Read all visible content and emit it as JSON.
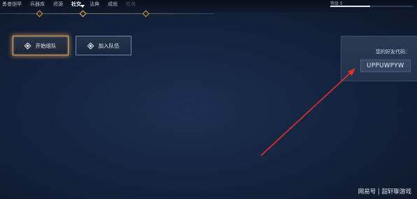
{
  "nav": {
    "tabs": [
      {
        "label": "勇者铠甲",
        "state": "normal"
      },
      {
        "label": "兵器库",
        "state": "normal"
      },
      {
        "label": "资源",
        "state": "normal"
      },
      {
        "label": "社交",
        "state": "active"
      },
      {
        "label": "法典",
        "state": "normal"
      },
      {
        "label": "成就",
        "state": "normal"
      },
      {
        "label": "任务",
        "state": "disabled"
      }
    ],
    "top_right_label": "等级 5",
    "progress": 0.48
  },
  "actions": {
    "start_team_label": "开始组队",
    "join_team_label": "加入队伍"
  },
  "friend_code": {
    "label": "您的好友代码：",
    "code": "UPPUWPYW"
  },
  "annotation": {
    "arrow_color": "#e0302a"
  },
  "watermark": "网易号 | 韶轩聊游戏"
}
